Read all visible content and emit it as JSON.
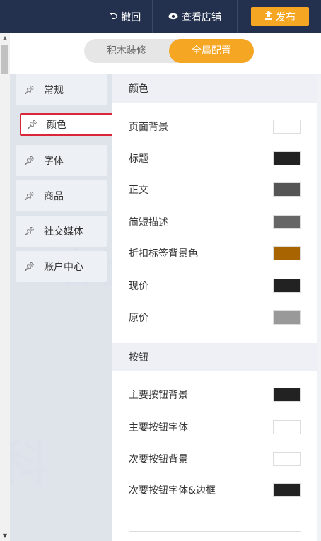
{
  "header": {
    "undo_label": "撤回",
    "view_store_label": "查看店铺",
    "publish_label": "发布",
    "colors": {
      "bar": "#23314f",
      "publish": "#f5a623"
    }
  },
  "tabs": [
    {
      "label": "积木装修",
      "active": false
    },
    {
      "label": "全局配置",
      "active": true
    }
  ],
  "sidebar": {
    "items": [
      {
        "label": "常规",
        "active": false
      },
      {
        "label": "颜色",
        "active": true
      },
      {
        "label": "字体",
        "active": false
      },
      {
        "label": "商品",
        "active": false
      },
      {
        "label": "社交媒体",
        "active": false
      },
      {
        "label": "账户中心",
        "active": false
      }
    ]
  },
  "sections": [
    {
      "title": "颜色",
      "rows": [
        {
          "label": "页面背景",
          "color": "#ffffff"
        },
        {
          "label": "标题",
          "color": "#222222"
        },
        {
          "label": "正文",
          "color": "#555555"
        },
        {
          "label": "简短描述",
          "color": "#666666"
        },
        {
          "label": "折扣标签背景色",
          "color": "#a86400"
        },
        {
          "label": "现价",
          "color": "#222222"
        },
        {
          "label": "原价",
          "color": "#999999"
        }
      ]
    },
    {
      "title": "按钮",
      "rows": [
        {
          "label": "主要按钮背景",
          "color": "#222222"
        },
        {
          "label": "主要按钮字体",
          "color": "#ffffff"
        },
        {
          "label": "次要按钮背景",
          "color": "#ffffff"
        },
        {
          "label": "次要按钮字体&边框",
          "color": "#222222"
        }
      ]
    }
  ],
  "icons": {
    "undo": "undo-icon",
    "view": "eye-icon",
    "publish": "upload-icon",
    "pin": "pin-icon"
  }
}
